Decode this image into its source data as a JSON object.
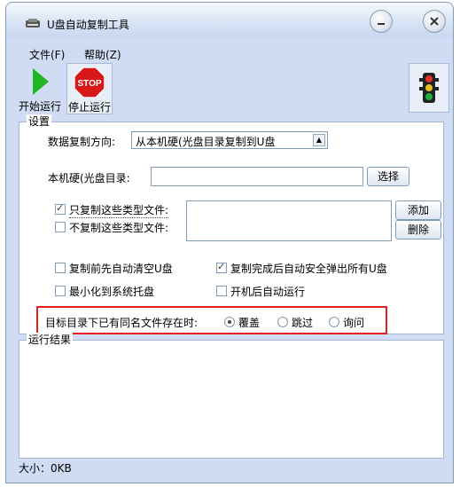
{
  "window": {
    "title": "U盘自动复制工具"
  },
  "menu": {
    "items": [
      "文件(F)",
      "帮助(Z)"
    ]
  },
  "toolbar": {
    "start_label": "开始运行",
    "stop_label": "停止运行",
    "stop_sign_text": "STOP"
  },
  "settings": {
    "group_title": "设置",
    "direction_label": "数据复制方向:",
    "direction_value": "从本机硬(光盘目录复制到U盘",
    "source_dir_label": "本机硬(光盘目录:",
    "source_dir_value": "",
    "browse_label": "选择",
    "only_copy_label": "只复制这些类型文件:",
    "only_copy_checked": true,
    "no_copy_label": "不复制这些类型文件:",
    "no_copy_checked": false,
    "types_value": "",
    "add_label": "添加",
    "delete_label": "删除",
    "clear_before_label": "复制前先自动清空U盘",
    "clear_before_checked": false,
    "eject_after_label": "复制完成后自动安全弹出所有U盘",
    "eject_after_checked": true,
    "minimize_tray_label": "最小化到系统托盘",
    "minimize_tray_checked": false,
    "autostart_label": "开机后自动运行",
    "autostart_checked": false,
    "conflict_label": "目标目录下已有同名文件存在时:",
    "conflict_options": [
      "覆盖",
      "跳过",
      "询问"
    ],
    "conflict_selected": "覆盖"
  },
  "result": {
    "group_title": "运行结果",
    "content": ""
  },
  "status": {
    "size_text": "大小：0KB"
  },
  "colors": {
    "accent_red": "#e02020",
    "start_green": "#21b521",
    "stop_red": "#d81818"
  }
}
